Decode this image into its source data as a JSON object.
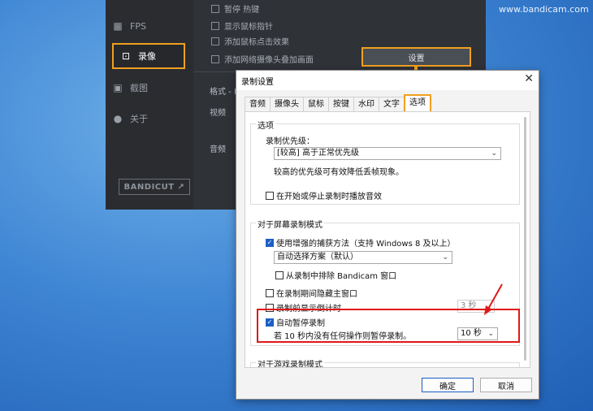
{
  "watermark": "www.bandicam.com",
  "background_app": {
    "sidebar": {
      "items": [
        {
          "label": "FPS",
          "icon": "fps-icon"
        },
        {
          "label": "录像",
          "icon": "video-icon"
        },
        {
          "label": "截图",
          "icon": "image-icon"
        },
        {
          "label": "关于",
          "icon": "info-icon"
        }
      ],
      "bandicut": "BANDICUT ↗"
    },
    "checks": [
      "暂停 热键",
      "显示鼠标指针",
      "添加鼠标点击效果",
      "添加网络摄像头叠加画面"
    ],
    "settings_button": "设置",
    "format_label": "格式 - M",
    "video_label": "视频",
    "audio_label": "音频"
  },
  "dialog": {
    "title": "录制设置",
    "close": "✕",
    "tabs": [
      "音频",
      "摄像头",
      "鼠标",
      "按键",
      "水印",
      "文字",
      "选项"
    ],
    "active_tab": "选项",
    "options_group": {
      "title": "选项",
      "priority_label": "录制优先级：",
      "priority_value": "[较高] 高于正常优先级",
      "priority_note": "较高的优先级可有效降低丢帧现象。",
      "play_sound": "在开始或停止录制时播放音效"
    },
    "screen_group": {
      "title": "对于屏幕录制模式",
      "enhanced_capture": "使用增强的捕获方法（支持 Windows 8 及以上）",
      "capture_select": "自动选择方案（默认）",
      "exclude_window": "从录制中排除 Bandicam 窗口",
      "hide_window": "在录制期间隐藏主窗口",
      "countdown": "录制前显示倒计时",
      "countdown_value": "3 秒",
      "auto_pause": "自动暂停录制",
      "auto_pause_desc": "若 10 秒内没有任何操作则暂停录制。",
      "auto_pause_value": "10 秒"
    },
    "game_group": {
      "title": "对于游戏录制模式"
    },
    "ok": "确定",
    "cancel": "取消"
  }
}
